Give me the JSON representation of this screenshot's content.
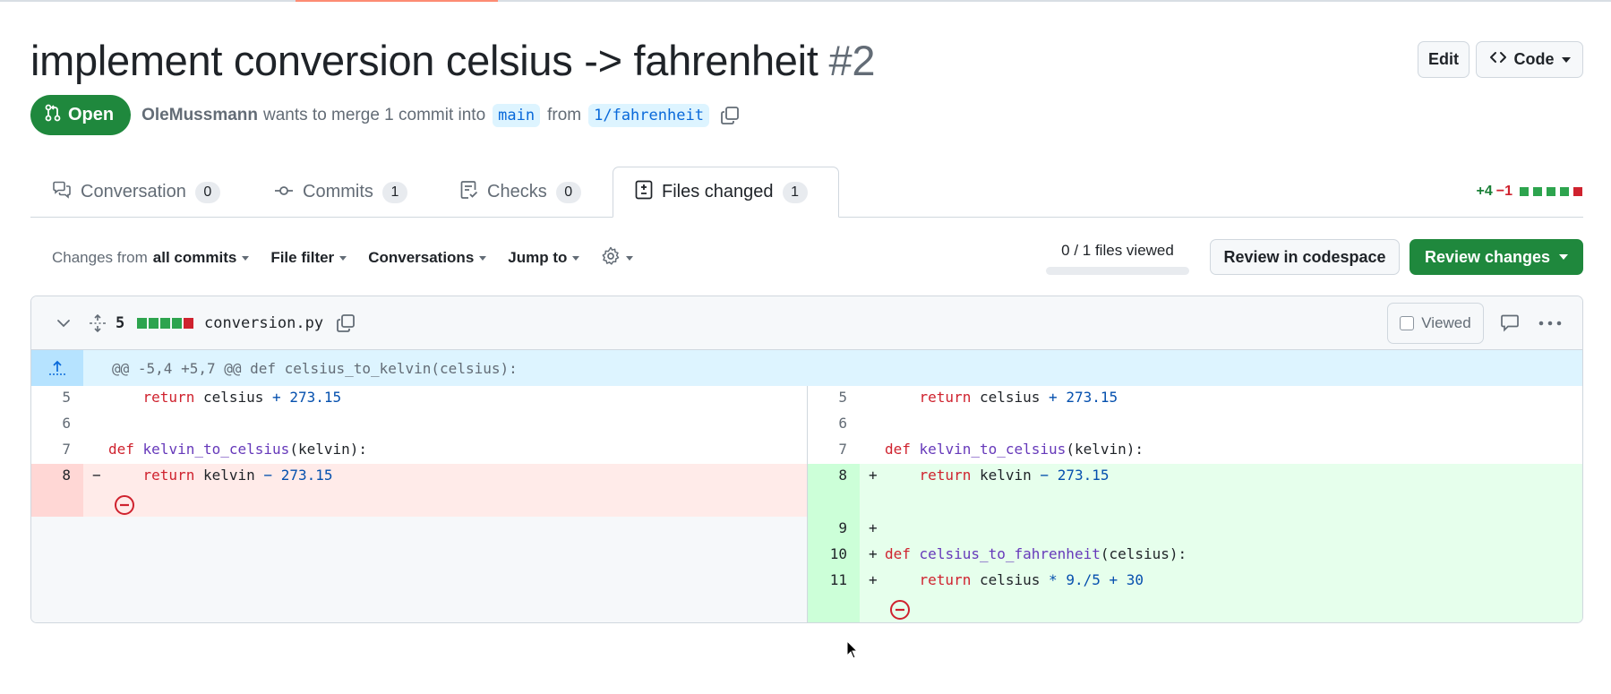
{
  "pr": {
    "title": "implement conversion celsius -> fahrenheit",
    "number": "#2",
    "edit_label": "Edit",
    "code_label": "Code",
    "state": "Open",
    "author": "OleMussmann",
    "merge_text": "wants to merge 1 commit into",
    "base_branch": "main",
    "from_text": "from",
    "head_branch": "1/fahrenheit"
  },
  "tabs": [
    {
      "label": "Conversation",
      "count": "0"
    },
    {
      "label": "Commits",
      "count": "1"
    },
    {
      "label": "Checks",
      "count": "0"
    },
    {
      "label": "Files changed",
      "count": "1"
    }
  ],
  "diffstat": {
    "additions": "+4",
    "deletions": "−1"
  },
  "toolbar": {
    "changes_prefix": "Changes from",
    "changes_value": "all commits",
    "file_filter": "File filter",
    "conversations": "Conversations",
    "jump_to": "Jump to",
    "files_viewed": "0 / 1 files viewed",
    "codespace": "Review in codespace",
    "review_changes": "Review changes"
  },
  "file": {
    "change_count": "5",
    "name": "conversion.py",
    "viewed_label": "Viewed",
    "hunk_header": "@@ -5,4 +5,7 @@ def celsius_to_kelvin(celsius):"
  },
  "diff": {
    "left": [
      {
        "ln": "5"
      },
      {
        "ln": "6"
      },
      {
        "ln": "7"
      },
      {
        "ln": "8",
        "marker": "−"
      }
    ],
    "right": [
      {
        "ln": "5"
      },
      {
        "ln": "6"
      },
      {
        "ln": "7"
      },
      {
        "ln": "8",
        "marker": "+"
      },
      {
        "ln": "9",
        "marker": "+"
      },
      {
        "ln": "10",
        "marker": "+"
      },
      {
        "ln": "11",
        "marker": "+"
      }
    ],
    "tokens": {
      "return": "return",
      "def": "def",
      "celsius": "celsius",
      "kelvin": "kelvin",
      "plus": "+",
      "minus": "−",
      "times": "*",
      "n27315": "273.15",
      "n95": "9./5",
      "n30": "30",
      "kelvin_to_celsius": "kelvin_to_celsius",
      "celsius_to_fahrenheit": "celsius_to_fahrenheit",
      "paren_kelvin": "(kelvin):",
      "paren_celsius": "(celsius):"
    }
  },
  "colors": {
    "open_green": "#1f883d",
    "accent_link": "#0969da",
    "deletion": "#cf222e",
    "addition": "#1a7f37"
  }
}
